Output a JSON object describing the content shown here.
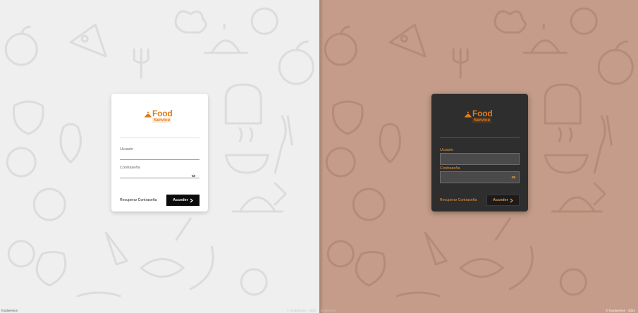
{
  "login": {
    "brand_word": "Food",
    "brand_sub": "Service",
    "username_label": "Usuario",
    "password_label": "Contraseña",
    "recover_link": "Recuperar Contraseña",
    "submit_label": "Acceder",
    "submit_icon": "chevron-right-icon",
    "password_toggle_icon": "eye-icon"
  },
  "footer": {
    "left_text": "foodservice",
    "right_text": "© foodservice - 2024"
  },
  "themes": {
    "light": {
      "background": "#efefef",
      "card": "#ffffff",
      "button": "#0b0b0b",
      "accent": "#e07b19"
    },
    "dark": {
      "background": "#c49c89",
      "card": "#2e2e2e",
      "button": "#1b1b1b",
      "accent": "#e8933e"
    }
  }
}
